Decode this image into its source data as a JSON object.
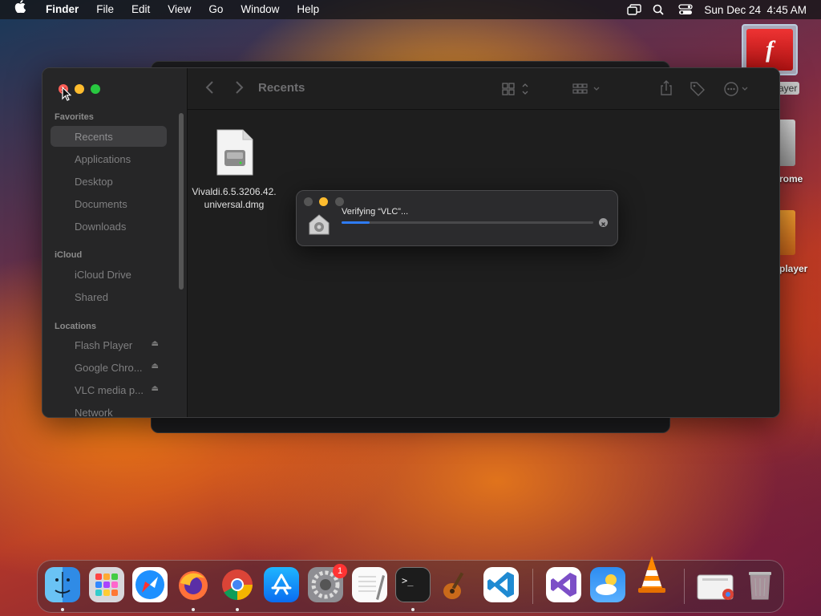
{
  "menubar": {
    "apple": "",
    "app_name": "Finder",
    "menus": [
      "File",
      "Edit",
      "View",
      "Go",
      "Window",
      "Help"
    ],
    "datetime": "Sun Dec 24  4:45 AM",
    "icons": [
      "screen-mirroring-icon",
      "spotlight-icon",
      "control-center-icon"
    ]
  },
  "desktop": {
    "items": [
      {
        "label": "Flash Player",
        "visible_label": "ayer",
        "icon": "flash-player-icon"
      },
      {
        "label": "Google Chrome",
        "visible_label": "rome",
        "icon": "disk-image-icon"
      },
      {
        "label": "VLC media player",
        "visible_label": "player",
        "icon": "disk-image-icon"
      }
    ]
  },
  "finder": {
    "title": "Recents",
    "sidebar": {
      "favorites_heading": "Favorites",
      "favorites": [
        "Recents",
        "Applications",
        "Desktop",
        "Documents",
        "Downloads"
      ],
      "icloud_heading": "iCloud",
      "icloud": [
        "iCloud Drive",
        "Shared"
      ],
      "locations_heading": "Locations",
      "locations": [
        "Flash Player",
        "Google Chro...",
        "VLC media p...",
        "Network"
      ]
    },
    "toolbar_icons": [
      "back-icon",
      "forward-icon",
      "view-grid-icon",
      "group-icon",
      "share-icon",
      "tag-icon",
      "more-icon",
      "search-icon"
    ],
    "file": {
      "name": "Vivaldi.6.5.3206.42.universal.dmg",
      "icon": "disk-image-icon"
    }
  },
  "verify_dialog": {
    "text": "Verifying “VLC”...",
    "progress": 0.11,
    "icon": "installer-gear-icon"
  },
  "dock": {
    "apps": [
      {
        "name": "Finder",
        "icon": "finder-icon",
        "running": true
      },
      {
        "name": "Launchpad",
        "icon": "launchpad-icon",
        "running": false
      },
      {
        "name": "Safari",
        "icon": "safari-icon",
        "running": false
      },
      {
        "name": "Firefox",
        "icon": "firefox-icon",
        "running": true
      },
      {
        "name": "Google Chrome",
        "icon": "chrome-icon",
        "running": true
      },
      {
        "name": "App Store",
        "icon": "app-store-icon",
        "running": false
      },
      {
        "name": "System Settings",
        "icon": "system-settings-icon",
        "running": false,
        "badge": "1"
      },
      {
        "name": "TextEdit",
        "icon": "textedit-icon",
        "running": false
      },
      {
        "name": "Terminal",
        "icon": "terminal-icon",
        "running": true
      },
      {
        "name": "GarageBand",
        "icon": "garageband-icon",
        "running": false
      },
      {
        "name": "Visual Studio Code",
        "icon": "vscode-icon",
        "running": false
      },
      {
        "name": "Visual Studio",
        "icon": "visual-studio-icon",
        "running": false
      },
      {
        "name": "Weather",
        "icon": "weather-icon",
        "running": false
      },
      {
        "name": "VLC",
        "icon": "vlc-icon",
        "running": false
      },
      {
        "name": "Google Chrome Installer",
        "icon": "chrome-installer-icon",
        "running": false
      },
      {
        "name": "Trash",
        "icon": "trash-icon",
        "running": false
      }
    ]
  },
  "colors": {
    "accent": "#2f7cf6",
    "close": "#ff5f57",
    "minimize": "#febc2e",
    "zoom": "#28c840"
  }
}
